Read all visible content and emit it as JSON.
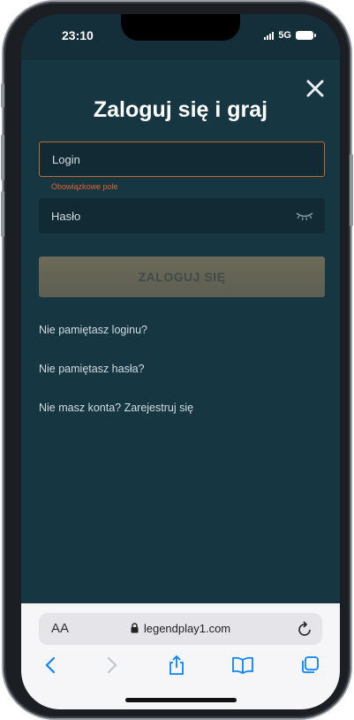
{
  "status_bar": {
    "time": "23:10",
    "network": "5G"
  },
  "login_modal": {
    "title": "Zaloguj się i graj",
    "login_placeholder": "Login",
    "login_error": "Obowiązkowe pole",
    "password_placeholder": "Hasło",
    "submit_label": "ZALOGUJ SIĘ",
    "links": {
      "forgot_login": "Nie pamiętasz loginu?",
      "forgot_password": "Nie pamiętasz hasła?",
      "register": "Nie masz konta? Zarejestruj się"
    }
  },
  "browser": {
    "text_size_label": "AA",
    "url": "legendplay1.com"
  },
  "icons": {
    "close": "close-icon",
    "eye": "eye-closed-icon",
    "lock": "lock-icon",
    "reload": "reload-icon",
    "back": "back-icon",
    "forward": "forward-icon",
    "share": "share-icon",
    "bookmarks": "bookmarks-icon",
    "tabs": "tabs-icon"
  },
  "colors": {
    "background": "#163642",
    "accent_error": "#e0652f",
    "ios_blue": "#0a84ff"
  }
}
